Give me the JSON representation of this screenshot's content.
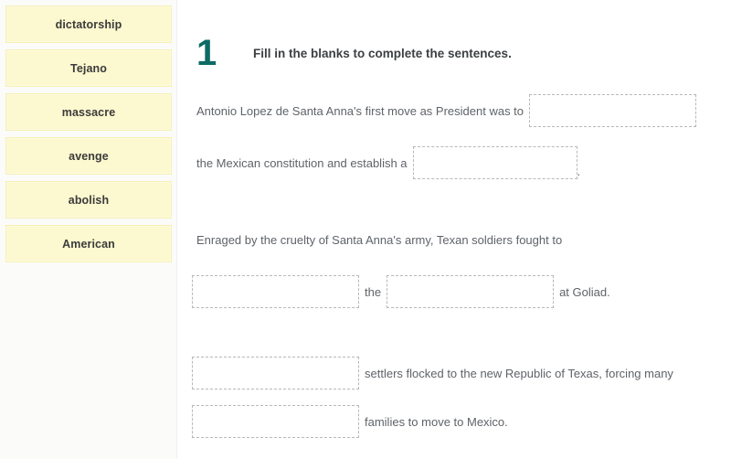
{
  "word_bank": {
    "tiles": [
      {
        "label": "dictatorship"
      },
      {
        "label": "Tejano"
      },
      {
        "label": "massacre"
      },
      {
        "label": "avenge"
      },
      {
        "label": "abolish"
      },
      {
        "label": "American"
      }
    ]
  },
  "question": {
    "number": "1",
    "prompt": "Fill in the blanks to complete the sentences.",
    "number_color": "#0d6b64"
  },
  "sentences": {
    "line1_text": "Antonio Lopez de Santa Anna's first move as President was to",
    "line2_text": "the Mexican constitution and establish a",
    "line2_period": ".",
    "line3_text": "Enraged by the cruelty of Santa Anna's army, Texan soldiers fought to",
    "line4_the": "the",
    "line4_tail": "at Goliad.",
    "line5_tail": "settlers flocked to the new Republic of Texas, forcing many",
    "line6_tail": "families to move to Mexico."
  },
  "blanks": {
    "blank1_value": "",
    "blank2_value": "",
    "blank3_value": "",
    "blank4_value": "",
    "blank5_value": "",
    "blank6_value": "",
    "placeholder": ""
  }
}
